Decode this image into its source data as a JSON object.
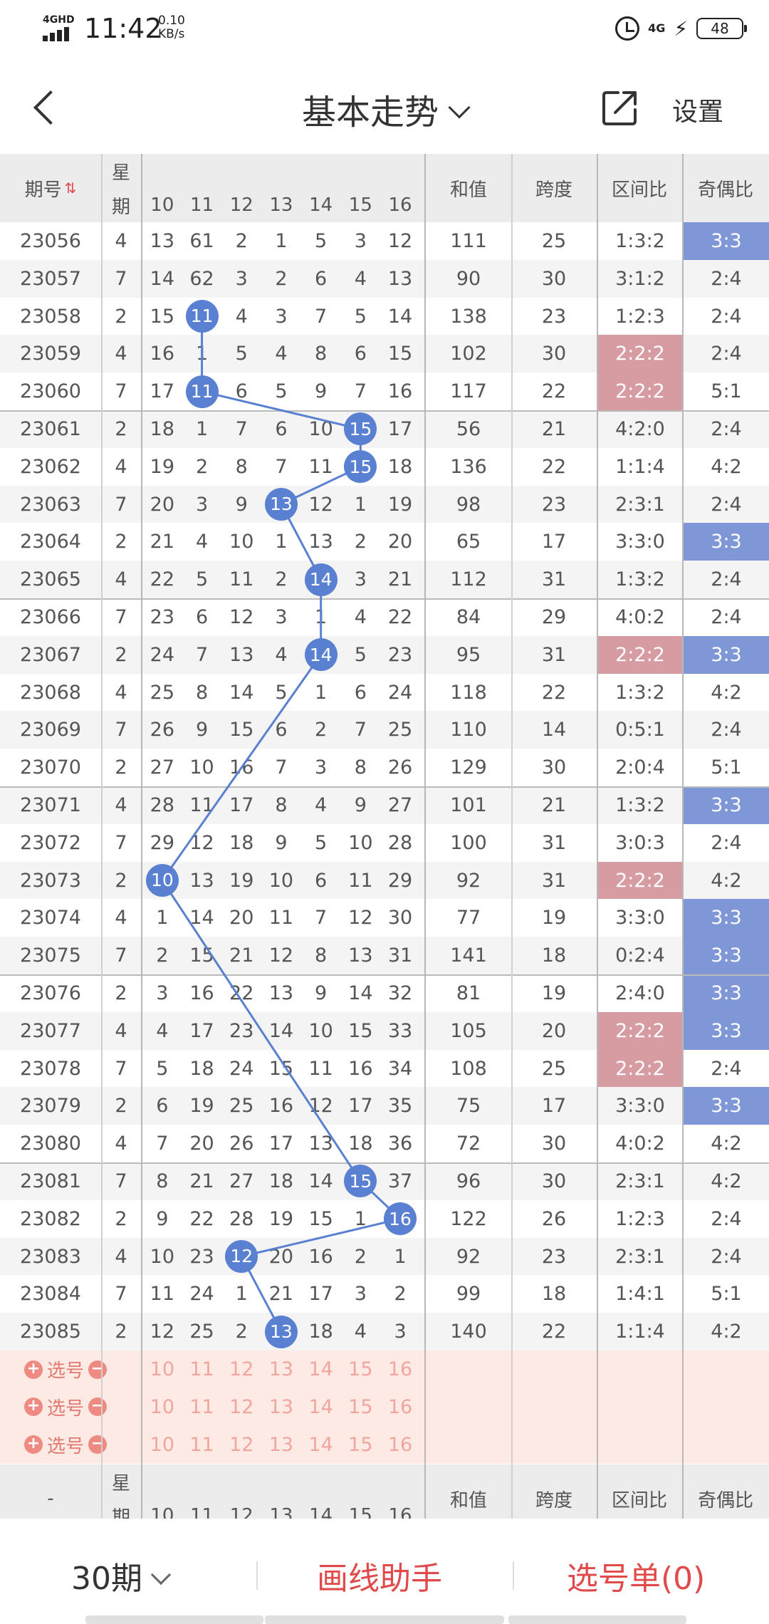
{
  "status": {
    "network": "4GHD",
    "time": "11:42",
    "speed_value": "0.10",
    "speed_unit": "KB/s",
    "signal_type": "4G",
    "battery": "48"
  },
  "header": {
    "title": "基本走势",
    "settings_label": "设置"
  },
  "table": {
    "col_period": "期号",
    "col_week_top": "星",
    "col_week_bottom": "期",
    "num_cols": [
      "10",
      "11",
      "12",
      "13",
      "14",
      "15",
      "16"
    ],
    "col_sum": "和值",
    "col_span": "跨度",
    "col_range": "区间比",
    "col_parity": "奇偶比",
    "rows": [
      {
        "period": "23056",
        "week": "4",
        "nums": [
          "13",
          "61",
          "2",
          "1",
          "5",
          "3",
          "12"
        ],
        "sum": "111",
        "span": "25",
        "range": "1:3:2",
        "parity": "3:3",
        "rangeHL": "",
        "parityHL": "blue"
      },
      {
        "period": "23057",
        "week": "7",
        "nums": [
          "14",
          "62",
          "3",
          "2",
          "6",
          "4",
          "13"
        ],
        "sum": "90",
        "span": "30",
        "range": "3:1:2",
        "parity": "2:4",
        "rangeHL": "",
        "parityHL": ""
      },
      {
        "period": "23058",
        "week": "2",
        "nums": [
          "15",
          "11",
          "4",
          "3",
          "7",
          "5",
          "14"
        ],
        "sum": "138",
        "span": "23",
        "range": "1:2:3",
        "parity": "2:4",
        "rangeHL": "",
        "parityHL": "",
        "ball": 1
      },
      {
        "period": "23059",
        "week": "4",
        "nums": [
          "16",
          "1",
          "5",
          "4",
          "8",
          "6",
          "15"
        ],
        "sum": "102",
        "span": "30",
        "range": "2:2:2",
        "parity": "2:4",
        "rangeHL": "pink",
        "parityHL": ""
      },
      {
        "period": "23060",
        "week": "7",
        "nums": [
          "17",
          "11",
          "6",
          "5",
          "9",
          "7",
          "16"
        ],
        "sum": "117",
        "span": "22",
        "range": "2:2:2",
        "parity": "5:1",
        "rangeHL": "pink",
        "parityHL": "",
        "ball": 1
      },
      {
        "period": "23061",
        "week": "2",
        "nums": [
          "18",
          "1",
          "7",
          "6",
          "10",
          "15",
          "17"
        ],
        "sum": "56",
        "span": "21",
        "range": "4:2:0",
        "parity": "2:4",
        "rangeHL": "",
        "parityHL": "",
        "ball": 5
      },
      {
        "period": "23062",
        "week": "4",
        "nums": [
          "19",
          "2",
          "8",
          "7",
          "11",
          "15",
          "18"
        ],
        "sum": "136",
        "span": "22",
        "range": "1:1:4",
        "parity": "4:2",
        "rangeHL": "",
        "parityHL": "",
        "ball": 5
      },
      {
        "period": "23063",
        "week": "7",
        "nums": [
          "20",
          "3",
          "9",
          "13",
          "12",
          "1",
          "19"
        ],
        "sum": "98",
        "span": "23",
        "range": "2:3:1",
        "parity": "2:4",
        "rangeHL": "",
        "parityHL": "",
        "ball": 3
      },
      {
        "period": "23064",
        "week": "2",
        "nums": [
          "21",
          "4",
          "10",
          "1",
          "13",
          "2",
          "20"
        ],
        "sum": "65",
        "span": "17",
        "range": "3:3:0",
        "parity": "3:3",
        "rangeHL": "",
        "parityHL": "blue"
      },
      {
        "period": "23065",
        "week": "4",
        "nums": [
          "22",
          "5",
          "11",
          "2",
          "14",
          "3",
          "21"
        ],
        "sum": "112",
        "span": "31",
        "range": "1:3:2",
        "parity": "2:4",
        "rangeHL": "",
        "parityHL": "",
        "ball": 4
      },
      {
        "period": "23066",
        "week": "7",
        "nums": [
          "23",
          "6",
          "12",
          "3",
          "1",
          "4",
          "22"
        ],
        "sum": "84",
        "span": "29",
        "range": "4:0:2",
        "parity": "2:4",
        "rangeHL": "",
        "parityHL": ""
      },
      {
        "period": "23067",
        "week": "2",
        "nums": [
          "24",
          "7",
          "13",
          "4",
          "14",
          "5",
          "23"
        ],
        "sum": "95",
        "span": "31",
        "range": "2:2:2",
        "parity": "3:3",
        "rangeHL": "pink",
        "parityHL": "blue",
        "ball": 4
      },
      {
        "period": "23068",
        "week": "4",
        "nums": [
          "25",
          "8",
          "14",
          "5",
          "1",
          "6",
          "24"
        ],
        "sum": "118",
        "span": "22",
        "range": "1:3:2",
        "parity": "4:2",
        "rangeHL": "",
        "parityHL": ""
      },
      {
        "period": "23069",
        "week": "7",
        "nums": [
          "26",
          "9",
          "15",
          "6",
          "2",
          "7",
          "25"
        ],
        "sum": "110",
        "span": "14",
        "range": "0:5:1",
        "parity": "2:4",
        "rangeHL": "",
        "parityHL": ""
      },
      {
        "period": "23070",
        "week": "2",
        "nums": [
          "27",
          "10",
          "16",
          "7",
          "3",
          "8",
          "26"
        ],
        "sum": "129",
        "span": "30",
        "range": "2:0:4",
        "parity": "5:1",
        "rangeHL": "",
        "parityHL": ""
      },
      {
        "period": "23071",
        "week": "4",
        "nums": [
          "28",
          "11",
          "17",
          "8",
          "4",
          "9",
          "27"
        ],
        "sum": "101",
        "span": "21",
        "range": "1:3:2",
        "parity": "3:3",
        "rangeHL": "",
        "parityHL": "blue"
      },
      {
        "period": "23072",
        "week": "7",
        "nums": [
          "29",
          "12",
          "18",
          "9",
          "5",
          "10",
          "28"
        ],
        "sum": "100",
        "span": "31",
        "range": "3:0:3",
        "parity": "2:4",
        "rangeHL": "",
        "parityHL": ""
      },
      {
        "period": "23073",
        "week": "2",
        "nums": [
          "10",
          "13",
          "19",
          "10",
          "6",
          "11",
          "29"
        ],
        "sum": "92",
        "span": "31",
        "range": "2:2:2",
        "parity": "4:2",
        "rangeHL": "pink",
        "parityHL": "",
        "ball": 0
      },
      {
        "period": "23074",
        "week": "4",
        "nums": [
          "1",
          "14",
          "20",
          "11",
          "7",
          "12",
          "30"
        ],
        "sum": "77",
        "span": "19",
        "range": "3:3:0",
        "parity": "3:3",
        "rangeHL": "",
        "parityHL": "blue"
      },
      {
        "period": "23075",
        "week": "7",
        "nums": [
          "2",
          "15",
          "21",
          "12",
          "8",
          "13",
          "31"
        ],
        "sum": "141",
        "span": "18",
        "range": "0:2:4",
        "parity": "3:3",
        "rangeHL": "",
        "parityHL": "blue"
      },
      {
        "period": "23076",
        "week": "2",
        "nums": [
          "3",
          "16",
          "22",
          "13",
          "9",
          "14",
          "32"
        ],
        "sum": "81",
        "span": "19",
        "range": "2:4:0",
        "parity": "3:3",
        "rangeHL": "",
        "parityHL": "blue"
      },
      {
        "period": "23077",
        "week": "4",
        "nums": [
          "4",
          "17",
          "23",
          "14",
          "10",
          "15",
          "33"
        ],
        "sum": "105",
        "span": "20",
        "range": "2:2:2",
        "parity": "3:3",
        "rangeHL": "pink",
        "parityHL": "blue"
      },
      {
        "period": "23078",
        "week": "7",
        "nums": [
          "5",
          "18",
          "24",
          "15",
          "11",
          "16",
          "34"
        ],
        "sum": "108",
        "span": "25",
        "range": "2:2:2",
        "parity": "2:4",
        "rangeHL": "pink",
        "parityHL": ""
      },
      {
        "period": "23079",
        "week": "2",
        "nums": [
          "6",
          "19",
          "25",
          "16",
          "12",
          "17",
          "35"
        ],
        "sum": "75",
        "span": "17",
        "range": "3:3:0",
        "parity": "3:3",
        "rangeHL": "",
        "parityHL": "blue"
      },
      {
        "period": "23080",
        "week": "4",
        "nums": [
          "7",
          "20",
          "26",
          "17",
          "13",
          "18",
          "36"
        ],
        "sum": "72",
        "span": "30",
        "range": "4:0:2",
        "parity": "4:2",
        "rangeHL": "",
        "parityHL": ""
      },
      {
        "period": "23081",
        "week": "7",
        "nums": [
          "8",
          "21",
          "27",
          "18",
          "14",
          "15",
          "37"
        ],
        "sum": "96",
        "span": "30",
        "range": "2:3:1",
        "parity": "4:2",
        "rangeHL": "",
        "parityHL": "",
        "ball": 5
      },
      {
        "period": "23082",
        "week": "2",
        "nums": [
          "9",
          "22",
          "28",
          "19",
          "15",
          "1",
          "16"
        ],
        "sum": "122",
        "span": "26",
        "range": "1:2:3",
        "parity": "2:4",
        "rangeHL": "",
        "parityHL": "",
        "ball": 6
      },
      {
        "period": "23083",
        "week": "4",
        "nums": [
          "10",
          "23",
          "12",
          "20",
          "16",
          "2",
          "1"
        ],
        "sum": "92",
        "span": "23",
        "range": "2:3:1",
        "parity": "2:4",
        "rangeHL": "",
        "parityHL": "",
        "ball": 2
      },
      {
        "period": "23084",
        "week": "7",
        "nums": [
          "11",
          "24",
          "1",
          "21",
          "17",
          "3",
          "2"
        ],
        "sum": "99",
        "span": "18",
        "range": "1:4:1",
        "parity": "5:1",
        "rangeHL": "",
        "parityHL": ""
      },
      {
        "period": "23085",
        "week": "2",
        "nums": [
          "12",
          "25",
          "2",
          "13",
          "18",
          "4",
          "3"
        ],
        "sum": "140",
        "span": "22",
        "range": "1:1:4",
        "parity": "4:2",
        "rangeHL": "",
        "parityHL": "",
        "ball": 3
      }
    ],
    "pick_label": "选号",
    "footer_dash": "-"
  },
  "bottom": {
    "period_label": "30期",
    "draw_helper": "画线助手",
    "pick_list": "选号单(0)"
  },
  "colors": {
    "ball_blue": "#5a80d2",
    "parity_blue": "#7f97d6",
    "range_pink": "#d69ca2",
    "accent_red": "#e04a4a",
    "pick_bg": "#fdeae4"
  }
}
